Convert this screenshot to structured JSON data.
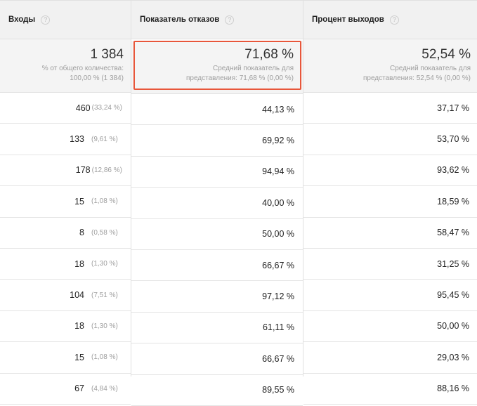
{
  "columns": [
    {
      "label": "Входы",
      "help": "?"
    },
    {
      "label": "Показатель отказов",
      "help": "?"
    },
    {
      "label": "Процент выходов",
      "help": "?"
    }
  ],
  "summary": {
    "entrances": {
      "value": "1 384",
      "line1": "% от общего количества:",
      "line2": "100,00 % (1 384)"
    },
    "bounce_rate": {
      "value": "71,68 %",
      "line1": "Средний показатель для",
      "line2": "представления: 71,68 % (0,00 %)"
    },
    "exit_rate": {
      "value": "52,54 %",
      "line1": "Средний показатель для",
      "line2": "представления: 52,54 % (0,00 %)"
    }
  },
  "highlight_color": "#e8563a",
  "rows": [
    {
      "entrances": "460",
      "entrances_pct": "(33,24 %)",
      "bounce": "44,13 %",
      "exit": "37,17 %"
    },
    {
      "entrances": "133",
      "entrances_pct": "(9,61 %)",
      "bounce": "69,92 %",
      "exit": "53,70 %"
    },
    {
      "entrances": "178",
      "entrances_pct": "(12,86 %)",
      "bounce": "94,94 %",
      "exit": "93,62 %"
    },
    {
      "entrances": "15",
      "entrances_pct": "(1,08 %)",
      "bounce": "40,00 %",
      "exit": "18,59 %"
    },
    {
      "entrances": "8",
      "entrances_pct": "(0,58 %)",
      "bounce": "50,00 %",
      "exit": "58,47 %"
    },
    {
      "entrances": "18",
      "entrances_pct": "(1,30 %)",
      "bounce": "66,67 %",
      "exit": "31,25 %"
    },
    {
      "entrances": "104",
      "entrances_pct": "(7,51 %)",
      "bounce": "97,12 %",
      "exit": "95,45 %"
    },
    {
      "entrances": "18",
      "entrances_pct": "(1,30 %)",
      "bounce": "61,11 %",
      "exit": "50,00 %"
    },
    {
      "entrances": "15",
      "entrances_pct": "(1,08 %)",
      "bounce": "66,67 %",
      "exit": "29,03 %"
    },
    {
      "entrances": "67",
      "entrances_pct": "(4,84 %)",
      "bounce": "89,55 %",
      "exit": "88,16 %"
    }
  ]
}
